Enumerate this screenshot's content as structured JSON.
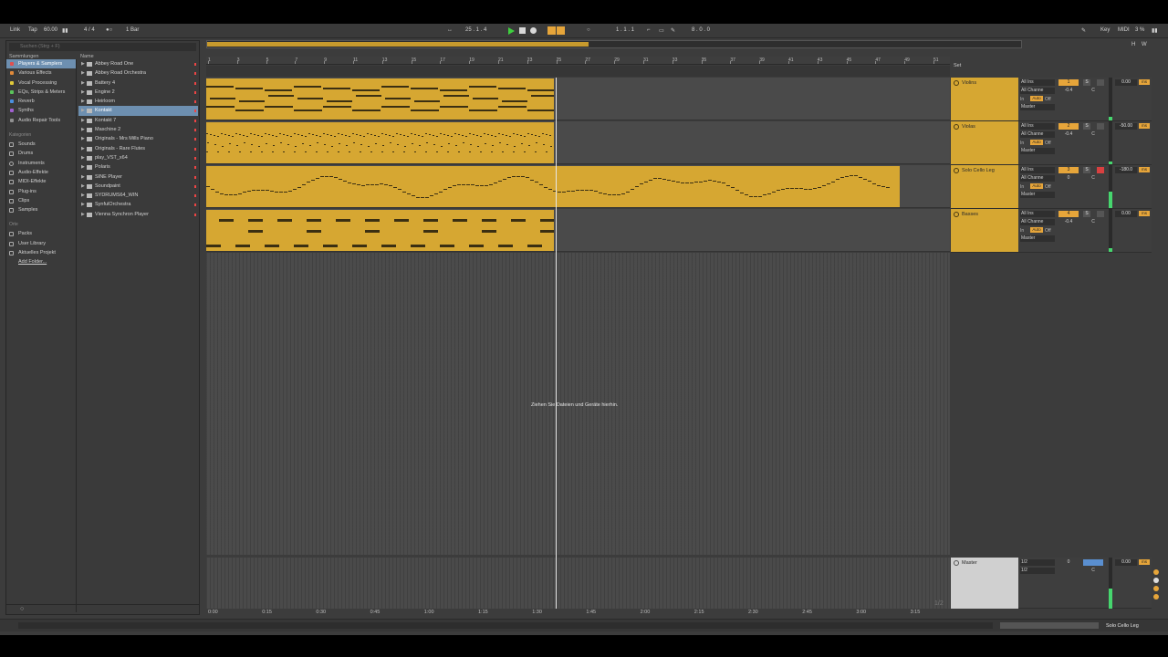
{
  "control_bar": {
    "link": "Link",
    "tap": "Tap",
    "tempo": "60.00",
    "signature": "4 / 4",
    "quant": "1 Bar",
    "position": "25 .  1 .  4",
    "loop_start": "1 .  1 .  1",
    "loop_length": "8 .  0 .  0",
    "key": "Key",
    "midi": "MIDI",
    "cpu": "3 %"
  },
  "browser": {
    "search_placeholder": "Suchen (Strg + F)",
    "collections_header": "Sammlungen",
    "name_header": "Name",
    "collections": [
      {
        "label": "Players & Samplers",
        "color": "#e05050"
      },
      {
        "label": "Various Effects",
        "color": "#e08a3a"
      },
      {
        "label": "Vocal Processing",
        "color": "#e0c93a"
      },
      {
        "label": "EQs, Strips & Meters",
        "color": "#5ac45a"
      },
      {
        "label": "Reverb",
        "color": "#4a8fe0"
      },
      {
        "label": "Synths",
        "color": "#a060d0"
      },
      {
        "label": "Audio Repair Tools",
        "color": "#909090"
      }
    ],
    "categories_header": "Kategorien",
    "categories": [
      "Sounds",
      "Drums",
      "Instruments",
      "Audio-Effekte",
      "MIDI-Effekte",
      "Plug-ins",
      "Clips",
      "Samples"
    ],
    "places_header": "Orte",
    "places": [
      "Packs",
      "User Library",
      "Aktuelles Projekt",
      "Add Folder..."
    ],
    "items": [
      "Abbey Road One",
      "Abbey Road Orchestra",
      "Battery 4",
      "Engine 2",
      "Heirloom",
      "Kontakt",
      "Kontakt 7",
      "Maschine 2",
      "Originals - Mrs Mills Piano",
      "Originals - Rare Flutes",
      "play_VST_x64",
      "Polaris",
      "SINE Player",
      "Soundpaint",
      "SYDRUMS64_WIN",
      "SynfulOrchestra",
      "Vienna Synchron Player"
    ]
  },
  "arrangement": {
    "bars": [
      "1",
      "3",
      "5",
      "7",
      "9",
      "11",
      "13",
      "15",
      "17",
      "19",
      "21",
      "23",
      "25",
      "27",
      "29",
      "31",
      "33",
      "35",
      "37",
      "39",
      "41",
      "43",
      "45",
      "47",
      "49",
      "51"
    ],
    "times": [
      "0:00",
      "0:15",
      "0:30",
      "0:45",
      "1:00",
      "1:15",
      "1:30",
      "1:45",
      "2:00",
      "2:15",
      "2:30",
      "2:45",
      "3:00",
      "3:15"
    ],
    "drop_message": "Ziehen Sie Dateien und Geräte hierhin.",
    "page_indicator": "1/2",
    "set_label": "Set"
  },
  "tracks": [
    {
      "name": "Violins",
      "input": "All Ins",
      "channel": "All Channe",
      "output": "Master",
      "number": "1",
      "pan": "-0.4",
      "vol": "0.00",
      "armed": false
    },
    {
      "name": "Violas",
      "input": "All Ins",
      "channel": "All Channe",
      "output": "Master",
      "number": "2",
      "pan": "-0.4",
      "vol": "-50.00",
      "armed": false
    },
    {
      "name": "Solo Cello Leg",
      "input": "All Ins",
      "channel": "All Channe",
      "output": "Master",
      "number": "3",
      "pan": "0",
      "vol": "-180.0",
      "armed": true
    },
    {
      "name": "Basses",
      "input": "All Ins",
      "channel": "All Channe",
      "output": "Master",
      "number": "4",
      "pan": "-0.4",
      "vol": "0.00",
      "armed": false
    }
  ],
  "mixer_labels": {
    "in": "In",
    "auto": "Auto",
    "off": "Off",
    "solo": "S",
    "center": "C",
    "ms": "ms"
  },
  "master": {
    "name": "Master",
    "cue1": "1/2",
    "cue2": "1/2",
    "number": "0",
    "vol": "0.00"
  },
  "status": {
    "selected_track": "Solo Cello Leg"
  }
}
